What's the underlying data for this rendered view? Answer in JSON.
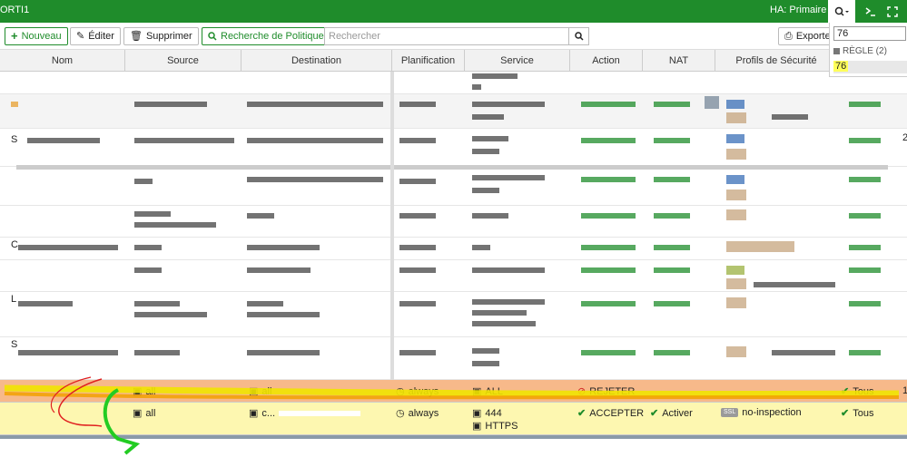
{
  "topbar": {
    "title": "ORTI1",
    "ha_status": "HA: Primaire",
    "search_icon": "search-icon",
    "cli_icon": "terminal-icon",
    "fullscreen_icon": "fullscreen-icon"
  },
  "toolbar": {
    "new_label": "Nouveau",
    "edit_label": "Éditer",
    "delete_label": "Supprimer",
    "policy_search_label": "Recherche de Politique",
    "search_placeholder": "Rechercher",
    "export_label": "Exporter"
  },
  "search_dropdown": {
    "query": "76",
    "group_label": "RÈGLE (2)",
    "result": "76"
  },
  "columns": [
    "Nom",
    "Source",
    "Destination",
    "Planification",
    "Service",
    "Action",
    "NAT",
    "Profils de Sécurité"
  ],
  "highlighted_rows": [
    {
      "source": "all",
      "destination": "all",
      "schedule": "always",
      "service": "ALL",
      "action": "REJETER",
      "nat": "",
      "security_profile": "",
      "log": "Tous",
      "extra": "1"
    },
    {
      "source": "all",
      "destination": "c...",
      "schedule": "always",
      "service_lines": [
        "444",
        "HTTPS"
      ],
      "action": "ACCEPTER",
      "nat": "Activer",
      "ssl_badge": "SSL",
      "security_profile": "no-inspection",
      "log": "Tous"
    }
  ],
  "partial_row_markers": {
    "s1": "S",
    "s2": "C",
    "s3": "L",
    "s4": "S",
    "side_value": "2"
  },
  "colors": {
    "brand_green": "#1f8c2b",
    "reject_row": "#f7b98a",
    "accept_row": "#fdf7b0",
    "highlight": "#ffff5a",
    "annotation_red": "#e02020",
    "annotation_green": "#22cc22",
    "annotation_yellow": "#f0e400"
  }
}
